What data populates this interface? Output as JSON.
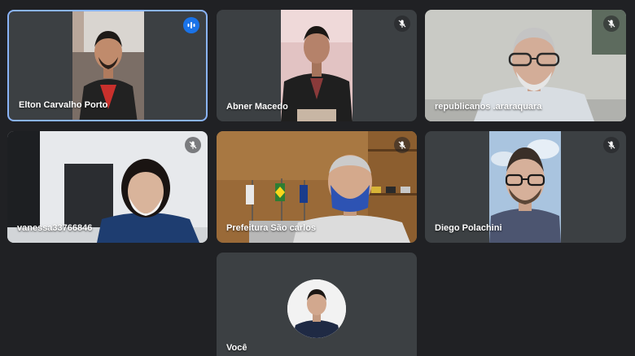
{
  "participants": [
    {
      "name": "Elton Carvalho Porto",
      "mic": "speaking-icon"
    },
    {
      "name": "Abner Macedo",
      "mic": "mic-off-icon"
    },
    {
      "name": "republicanos .araraquara",
      "mic": "mic-off-icon"
    },
    {
      "name": "vanessa33766846",
      "mic": "mic-off-icon"
    },
    {
      "name": "Prefeitura São carlos",
      "mic": "mic-off-icon"
    },
    {
      "name": "Diego Polachini",
      "mic": "mic-off-icon"
    },
    {
      "name": "Você",
      "mic": ""
    }
  ],
  "colors": {
    "background": "#202124",
    "tile": "#3c4043",
    "active_border": "#8ab4f8",
    "speaking": "#1a73e8"
  }
}
